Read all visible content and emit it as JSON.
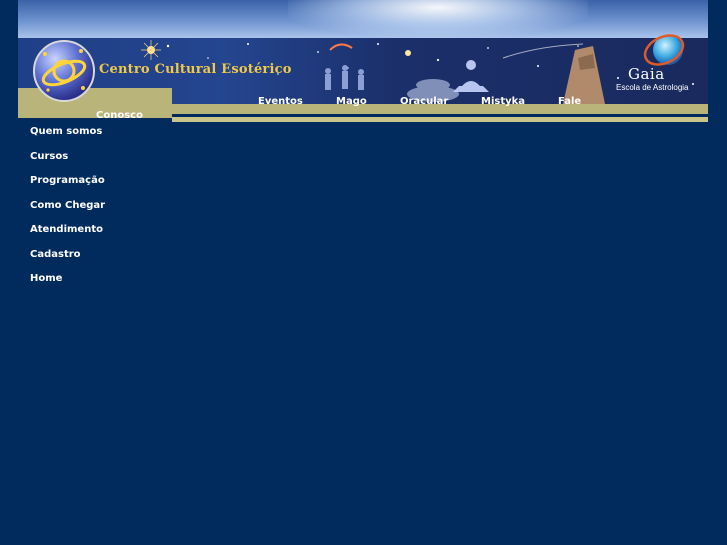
{
  "header": {
    "site_title": "Centro Cultural Esotérico",
    "brand_name": "Gaia",
    "brand_subtitle": "Escola de Astrologia"
  },
  "top_nav": {
    "items": [
      {
        "label": "Eventos"
      },
      {
        "label": "Mago"
      },
      {
        "label": "Oracular"
      },
      {
        "label": "Mistyka"
      },
      {
        "label": "Fale"
      }
    ],
    "wrapped_label": "Conosco"
  },
  "sidebar": {
    "items": [
      {
        "label": "Quem somos"
      },
      {
        "label": "Cursos"
      },
      {
        "label": "Programação"
      },
      {
        "label": "Como Chegar"
      },
      {
        "label": "Atendimento"
      },
      {
        "label": "Cadastro"
      },
      {
        "label": "Home"
      }
    ]
  },
  "colors": {
    "page_background": "#002b5c",
    "accent_khaki": "#b9b479",
    "title_gold": "#f0c84a",
    "nav_text": "#ffffff"
  },
  "icons": [
    "planet-logo-icon",
    "gaia-globe-icon"
  ]
}
